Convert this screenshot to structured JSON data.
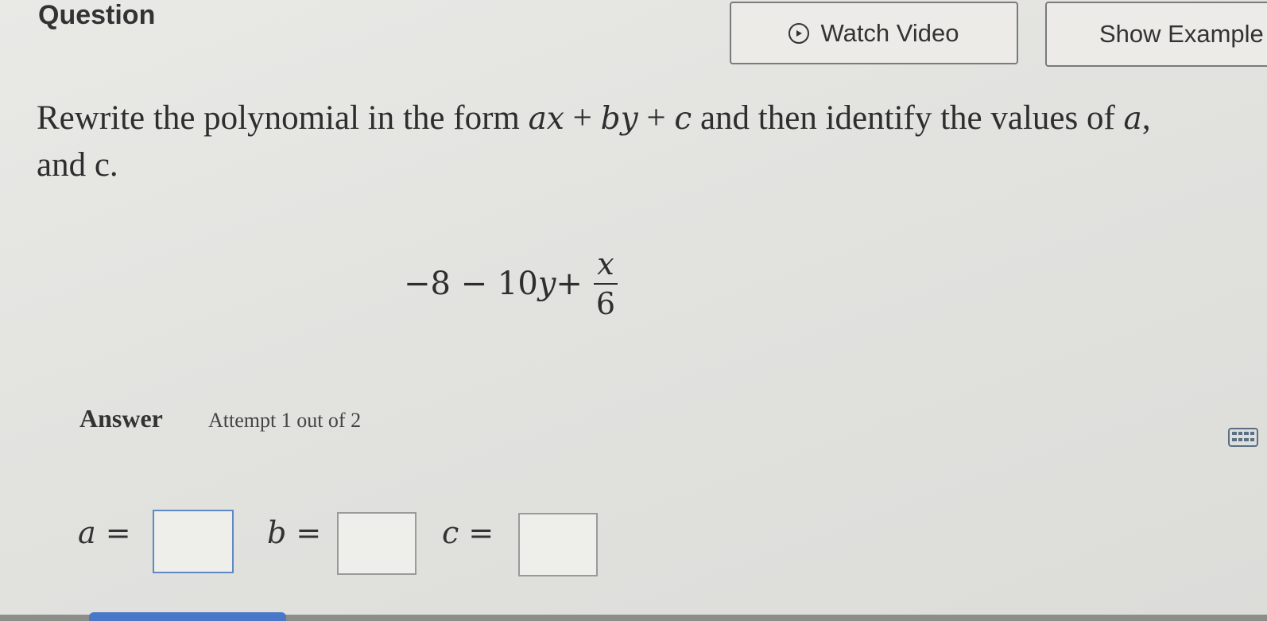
{
  "header": {
    "title": "Question",
    "watch_video_label": "Watch Video",
    "show_examples_label": "Show Example"
  },
  "problem": {
    "prompt_text_1": "Rewrite the polynomial in the form ",
    "form_ax": "ax",
    "form_plus1": " + ",
    "form_by": "by",
    "form_plus2": " + ",
    "form_c": "c",
    "prompt_text_2": " and then identify the values of ",
    "var_a": "a",
    "prompt_text_3": ",",
    "prompt_text_4": "and c.",
    "expression_main": "−8 − 10",
    "expression_y": "y",
    "expression_plus": " + ",
    "fraction_numerator": "x",
    "fraction_denominator": "6"
  },
  "answer": {
    "label": "Answer",
    "attempt_text": "Attempt 1 out of 2",
    "fields": [
      {
        "variable": "a",
        "equals": " =",
        "value": ""
      },
      {
        "variable": "b",
        "equals": " =",
        "value": ""
      },
      {
        "variable": "c",
        "equals": " =",
        "value": ""
      }
    ]
  },
  "icons": {
    "play": "play-circle-icon",
    "keyboard": "keyboard-icon"
  },
  "colors": {
    "accent": "#4a78c8",
    "active_box_border": "#5e89c4"
  }
}
